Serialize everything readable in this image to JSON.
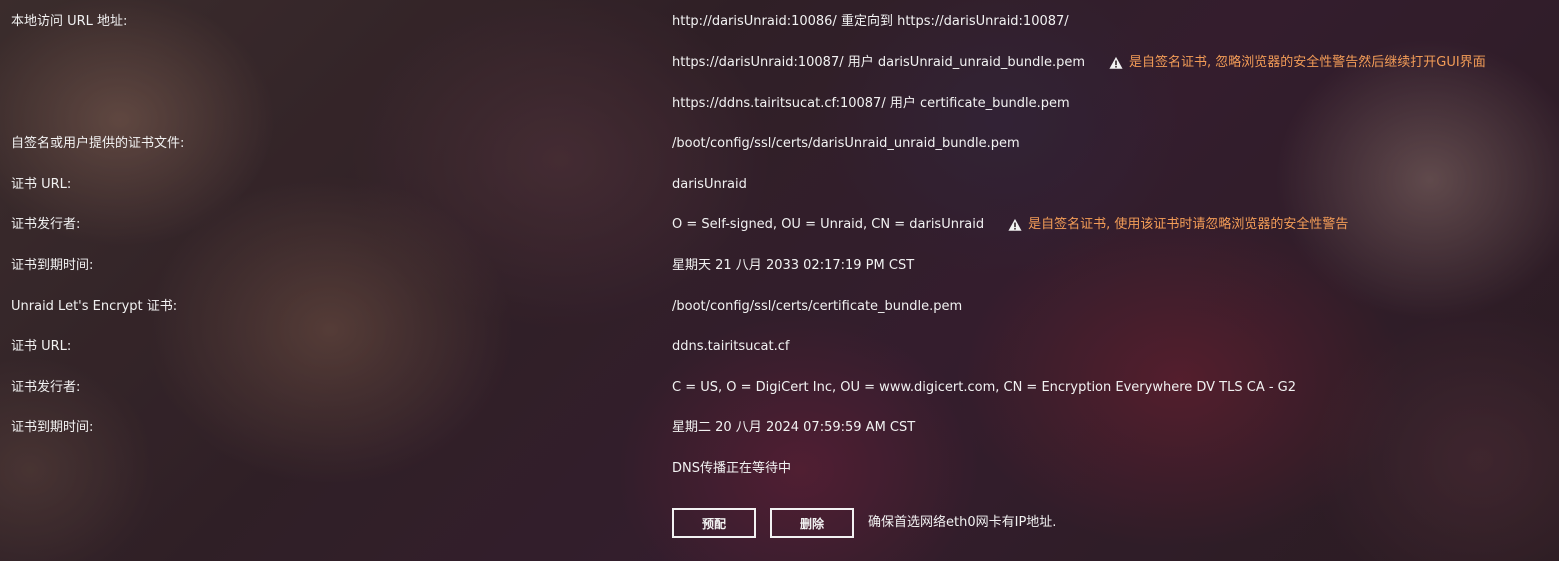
{
  "rows": [
    {
      "label": "本地访问 URL 地址:",
      "value": "http://darisUnraid:10086/ 重定向到 https://darisUnraid:10087/"
    },
    {
      "label": "",
      "value": "https://darisUnraid:10087/ 用户 darisUnraid_unraid_bundle.pem",
      "warning": "是自签名证书, 忽略浏览器的安全性警告然后继续打开GUI界面"
    },
    {
      "label": "",
      "value": "https://ddns.tairitsucat.cf:10087/ 用户 certificate_bundle.pem"
    },
    {
      "label": "自签名或用户提供的证书文件:",
      "value": "/boot/config/ssl/certs/darisUnraid_unraid_bundle.pem"
    },
    {
      "label": "证书 URL:",
      "value": "darisUnraid"
    },
    {
      "label": "证书发行者:",
      "value": "O = Self-signed, OU = Unraid, CN = darisUnraid",
      "warning": "是自签名证书, 使用该证书时请忽略浏览器的安全性警告"
    },
    {
      "label": "证书到期时间:",
      "value": "星期天 21 八月 2033 02:17:19 PM CST"
    },
    {
      "label": "Unraid Let's Encrypt 证书:",
      "value": "/boot/config/ssl/certs/certificate_bundle.pem"
    },
    {
      "label": "证书 URL:",
      "value": "ddns.tairitsucat.cf"
    },
    {
      "label": "证书发行者:",
      "value": "C = US, O = DigiCert Inc, OU = www.digicert.com, CN = Encryption Everywhere DV TLS CA - G2"
    },
    {
      "label": "证书到期时间:",
      "value": "星期二 20 八月 2024 07:59:59 AM CST"
    },
    {
      "label": "",
      "value": "DNS传播正在等待中"
    }
  ],
  "actions": {
    "provision_label": "预配",
    "delete_label": "删除",
    "note": "确保首选网络eth0网卡有IP地址."
  },
  "icons": {
    "warning": "warning-icon"
  },
  "colors": {
    "text": "#f2f2f2",
    "warning": "#f39c57"
  }
}
